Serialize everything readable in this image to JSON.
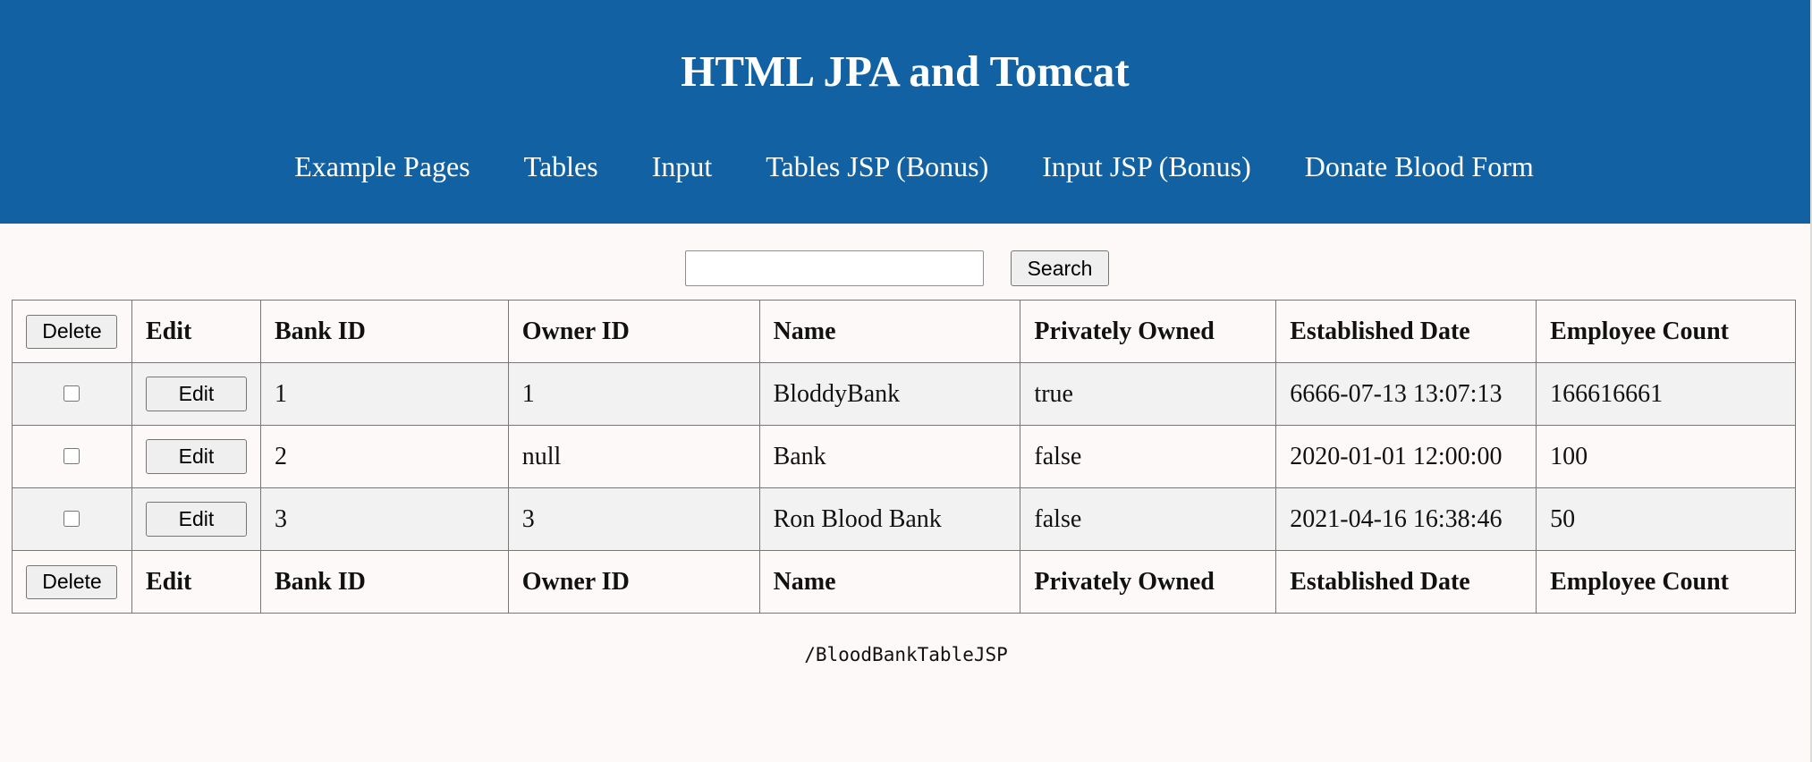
{
  "header": {
    "title": "HTML JPA and Tomcat",
    "nav": [
      "Example Pages",
      "Tables",
      "Input",
      "Tables JSP (Bonus)",
      "Input JSP (Bonus)",
      "Donate Blood Form"
    ]
  },
  "search": {
    "value": "",
    "button_label": "Search"
  },
  "table": {
    "delete_label": "Delete",
    "edit_label": "Edit",
    "headers": [
      "Edit",
      "Bank ID",
      "Owner ID",
      "Name",
      "Privately Owned",
      "Established Date",
      "Employee Count"
    ],
    "rows": [
      {
        "bank_id": "1",
        "owner_id": "1",
        "name": "BloddyBank",
        "privately_owned": "true",
        "established_date": "6666-07-13 13:07:13",
        "employee_count": "166616661"
      },
      {
        "bank_id": "2",
        "owner_id": "null",
        "name": "Bank",
        "privately_owned": "false",
        "established_date": "2020-01-01 12:00:00",
        "employee_count": "100"
      },
      {
        "bank_id": "3",
        "owner_id": "3",
        "name": "Ron Blood Bank",
        "privately_owned": "false",
        "established_date": "2021-04-16 16:38:46",
        "employee_count": "50"
      }
    ]
  },
  "footer": {
    "path": "/BloodBankTableJSP"
  },
  "colors": {
    "header_bg": "#1262a3",
    "page_bg": "#fdf9f8",
    "stripe_bg": "#f2f2f2"
  }
}
